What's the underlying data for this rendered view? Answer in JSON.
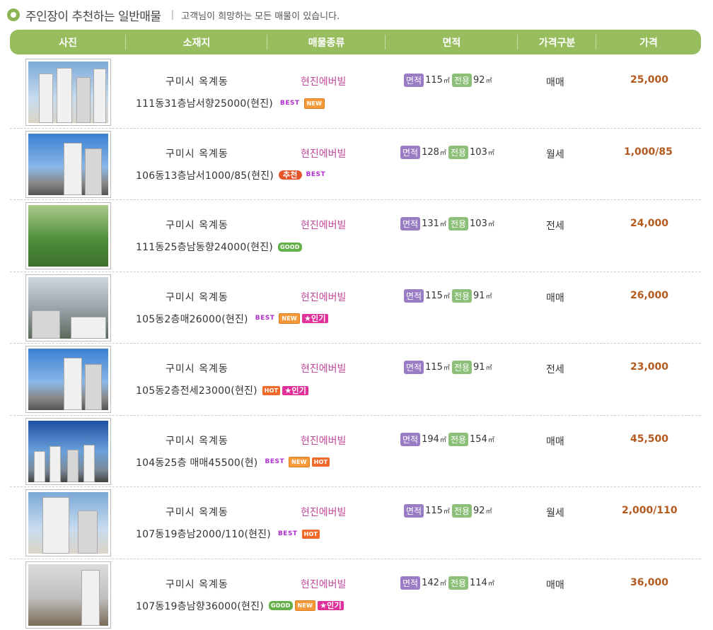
{
  "title": {
    "main": "주인장이 추천하는 일반매물",
    "separator": "|",
    "sub": "고객님이 희망하는 모든 매물이 있습니다."
  },
  "columns": {
    "photo": "사진",
    "location": "소재지",
    "type": "매물종류",
    "area": "면적",
    "deal": "가격구분",
    "price": "가격"
  },
  "area_labels": {
    "total": "면적",
    "exclusive": "전용",
    "unit": "㎡"
  },
  "badges": {
    "best": "BEST",
    "new": "NEW",
    "hot": "HOT",
    "good": "GOOD",
    "pop": "★인기",
    "rec": "추천"
  },
  "listings": [
    {
      "photo": "apartment-photo",
      "location": "구미시 옥계동",
      "type": "현진에버빌",
      "area_total": "115",
      "area_exclusive": "92",
      "deal": "매매",
      "price": "25,000",
      "desc": "111동31층남서향25000(현진)"
    },
    {
      "photo": "apartment-photo",
      "location": "구미시 옥계동",
      "type": "현진에버빌",
      "area_total": "128",
      "area_exclusive": "103",
      "deal": "월세",
      "price": "1,000/85",
      "desc": "106동13층남서1000/85(현진)"
    },
    {
      "photo": "apartment-photo",
      "location": "구미시 옥계동",
      "type": "현진에버빌",
      "area_total": "131",
      "area_exclusive": "103",
      "deal": "전세",
      "price": "24,000",
      "desc": "111동25층남동향24000(현진)"
    },
    {
      "photo": "apartment-photo",
      "location": "구미시 옥계동",
      "type": "현진에버빌",
      "area_total": "115",
      "area_exclusive": "91",
      "deal": "매매",
      "price": "26,000",
      "desc": "105동2층매26000(현진)"
    },
    {
      "photo": "apartment-photo",
      "location": "구미시 옥계동",
      "type": "현진에버빌",
      "area_total": "115",
      "area_exclusive": "91",
      "deal": "전세",
      "price": "23,000",
      "desc": "105동2층전세23000(현진)"
    },
    {
      "photo": "apartment-photo",
      "location": "구미시 옥계동",
      "type": "현진에버빌",
      "area_total": "194",
      "area_exclusive": "154",
      "deal": "매매",
      "price": "45,500",
      "desc": "104동25층 매매45500(현)"
    },
    {
      "photo": "apartment-photo",
      "location": "구미시 옥계동",
      "type": "현진에버빌",
      "area_total": "115",
      "area_exclusive": "92",
      "deal": "월세",
      "price": "2,000/110",
      "desc": "107동19층남2000/110(현진)"
    },
    {
      "photo": "apartment-photo",
      "location": "구미시 옥계동",
      "type": "현진에버빌",
      "area_total": "142",
      "area_exclusive": "114",
      "deal": "매매",
      "price": "36,000",
      "desc": "107동19층남향36000(현진)"
    }
  ]
}
